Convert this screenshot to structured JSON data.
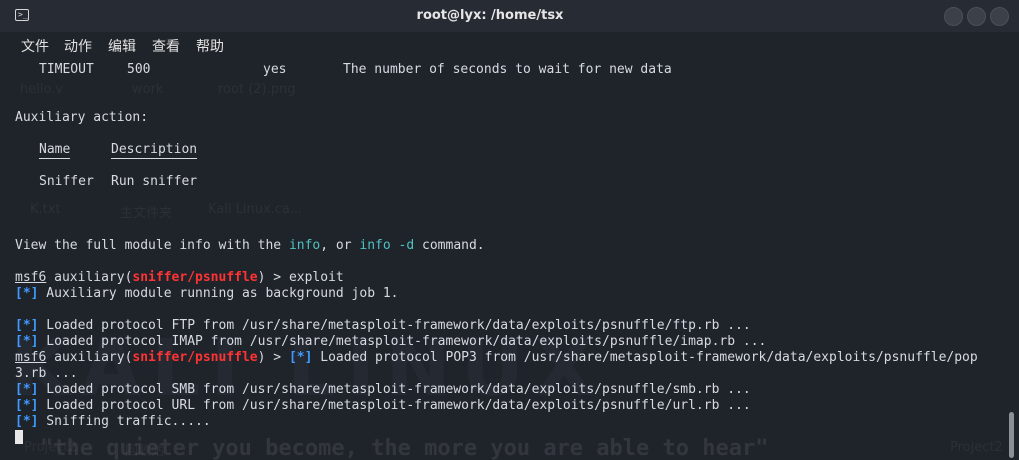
{
  "window": {
    "title": "root@lyx: /home/tsx",
    "terminal_icon": "terminal-icon",
    "controls": [
      "minimize",
      "maximize",
      "close"
    ]
  },
  "menu": [
    "文件",
    "动作",
    "编辑",
    "查看",
    "帮助"
  ],
  "desktop_watermarks": [
    "hello.v",
    "work",
    "root (2).png",
    "K.txt",
    "主文件夹",
    "Kali Linux.ca...",
    "Project2",
    "回收站",
    "Project2..."
  ],
  "terminal": {
    "timeout_row": {
      "name": "TIMEOUT",
      "setting": "500",
      "required": "yes",
      "description": "The number of seconds to wait for new data"
    },
    "aux_heading": "Auxiliary action:",
    "aux_col_name": "Name",
    "aux_col_desc": "Description",
    "aux_row": {
      "name": "Sniffer",
      "desc": "Run sniffer"
    },
    "view_info": {
      "pre": "View the full module info with the ",
      "cmd1": "info",
      "mid": ", or ",
      "cmd2": "info -d",
      "post": " command."
    },
    "prompt": {
      "msf": "msf6",
      "mid": " auxiliary(",
      "module": "sniffer/psnuffle",
      "end": ") > "
    },
    "command": "exploit",
    "status_marker": "[*]",
    "bg_job": " Auxiliary module running as background job 1.",
    "loaded_ftp": " Loaded protocol FTP from /usr/share/metasploit-framework/data/exploits/psnuffle/ftp.rb ...",
    "loaded_imap": " Loaded protocol IMAP from /usr/share/metasploit-framework/data/exploits/psnuffle/imap.rb ...",
    "loaded_pop3": " Loaded protocol POP3 from /usr/share/metasploit-framework/data/exploits/psnuffle/pop",
    "loaded_pop3_wrap": "3.rb ...",
    "loaded_smb": " Loaded protocol SMB from /usr/share/metasploit-framework/data/exploits/psnuffle/smb.rb ...",
    "loaded_url": " Loaded protocol URL from /usr/share/metasploit-framework/data/exploits/psnuffle/url.rb ...",
    "sniffing": " Sniffing traffic....."
  },
  "background": {
    "logo_text": "KALI LINUX",
    "quote": "\"the quieter you become, the more you are able to hear\""
  }
}
